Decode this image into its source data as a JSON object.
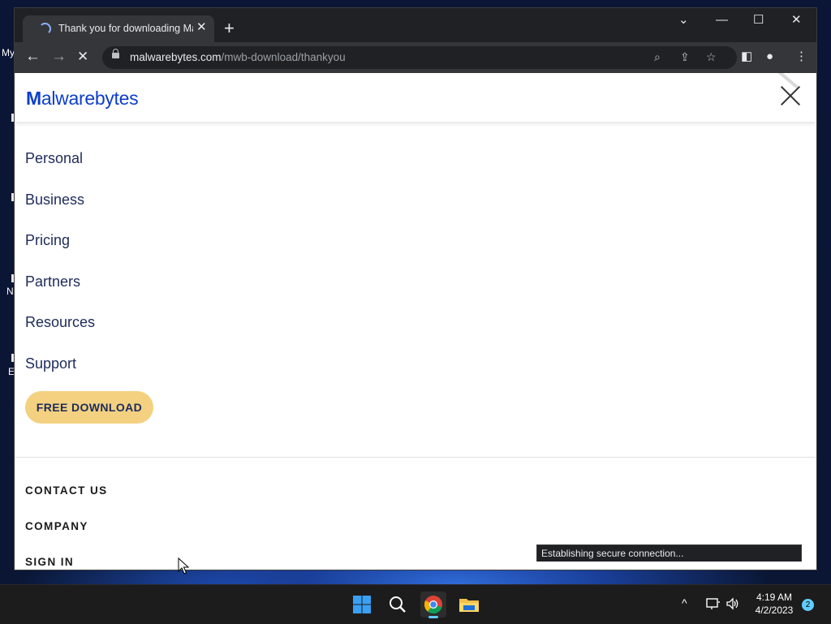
{
  "browser": {
    "tab": {
      "title": "Thank you for downloading Malwarebytes"
    },
    "window_controls": {
      "dropdown": "⌄",
      "minimize": "—",
      "maximize": "☐",
      "close": "✕"
    },
    "toolbar": {
      "back": "←",
      "forward": "→",
      "stop": "✕"
    },
    "address_bar": {
      "host": "malwarebytes.com",
      "path": "/mwb-download/thankyou"
    },
    "status_text": "Establishing secure connection..."
  },
  "site": {
    "logo": {
      "m_glyph": "M",
      "text": "alwarebytes"
    },
    "nav": [
      "Personal",
      "Business",
      "Pricing",
      "Partners",
      "Resources",
      "Support"
    ],
    "cta_label": "FREE DOWNLOAD",
    "secondary": [
      "CONTACT US",
      "COMPANY",
      "SIGN IN"
    ],
    "colors": {
      "brand": "#0d3ecc",
      "nav_text": "#1d2b5a",
      "cta_bg": "#f3d181"
    }
  },
  "desktop": {
    "fragments": [
      "My",
      "N",
      "E"
    ]
  },
  "taskbar": {
    "apps": [
      "start-icon",
      "search-icon",
      "chrome-icon",
      "file-explorer-icon"
    ],
    "time": "4:19 AM",
    "date": "4/2/2023",
    "notifications": "2",
    "tray_up": "^"
  }
}
